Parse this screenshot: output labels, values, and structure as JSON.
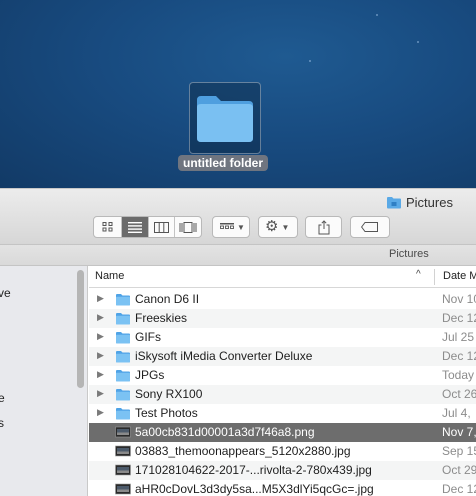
{
  "desktop": {
    "folder_label": "untitled folder"
  },
  "window": {
    "title": "Pictures",
    "path_label": "Pictures"
  },
  "toolbar": {
    "view_modes": [
      "icon-view",
      "list-view",
      "column-view",
      "cover-flow-view"
    ],
    "active_view": "list-view",
    "arrange_icon": "arrange-grid-icon",
    "action_icon": "gear-icon",
    "share_icon": "share-icon",
    "tags_icon": "tag-icon"
  },
  "sidebar": {
    "items": [
      "ve",
      "e",
      "s"
    ]
  },
  "columns": {
    "name": "Name",
    "date": "Date M",
    "sort_indicator": "^"
  },
  "files": [
    {
      "name": "Canon D6 II",
      "date": "Nov 10",
      "kind": "folder"
    },
    {
      "name": "Freeskies",
      "date": "Dec 12",
      "kind": "folder"
    },
    {
      "name": "GIFs",
      "date": "Jul 25",
      "kind": "folder"
    },
    {
      "name": "iSkysoft iMedia Converter Deluxe",
      "date": "Dec 12",
      "kind": "folder"
    },
    {
      "name": "JPGs",
      "date": "Today",
      "kind": "folder"
    },
    {
      "name": "Sony RX100",
      "date": "Oct 26",
      "kind": "folder"
    },
    {
      "name": "Test Photos",
      "date": "Jul 4,",
      "kind": "folder"
    },
    {
      "name": "5a00cb831d00001a3d7f46a8.png",
      "date": "Nov 7,",
      "kind": "image",
      "selected": true
    },
    {
      "name": "03883_themoonappears_5120x2880.jpg",
      "date": "Sep 15",
      "kind": "image"
    },
    {
      "name": "171028104622-2017-...rivolta-2-780x439.jpg",
      "date": "Oct 29",
      "kind": "image"
    },
    {
      "name": "aHR0cDovL3d3dy5sa...M5X3dlYi5qcGc=.jpg",
      "date": "Dec 12",
      "kind": "image"
    }
  ],
  "colors": {
    "desktop": "#184b80",
    "folder_blue": "#68b3ee",
    "selection": "#6d6d6d"
  }
}
